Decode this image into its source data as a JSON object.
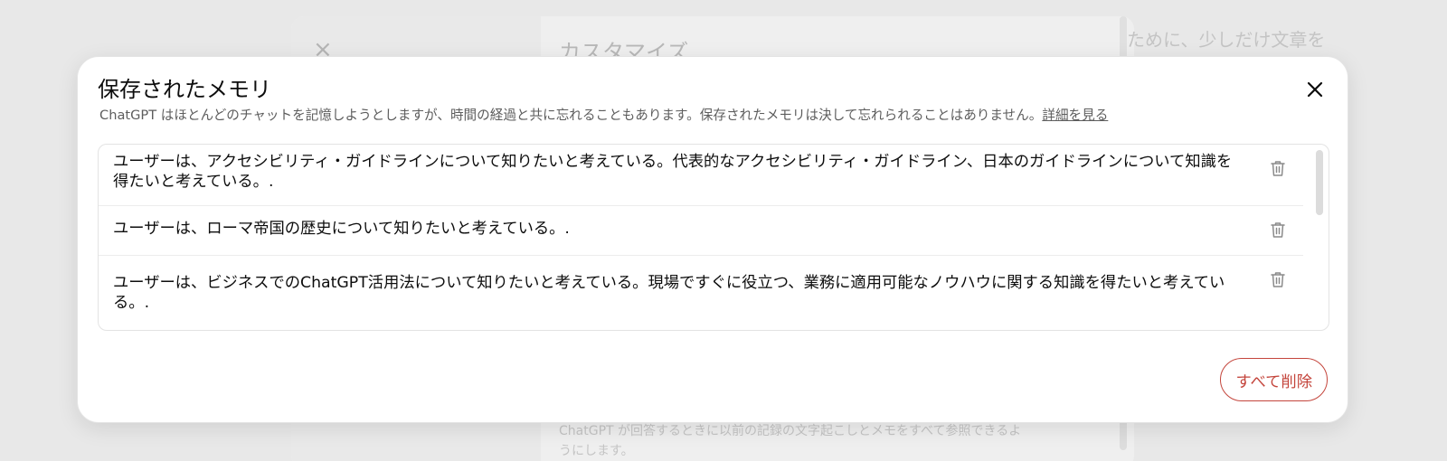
{
  "background": {
    "title": "カスタマイズ",
    "right_text": "ために、少しだけ文章を",
    "bottom_text": "ChatGPT が回答するときに以前の記録の文字起こしとメモをすべて参照できるようにします。"
  },
  "modal": {
    "title": "保存されたメモリ",
    "description": "ChatGPT はほとんどのチャットを記憶しようとしますが、時間の経過と共に忘れることもあります。保存されたメモリは決して忘れられることはありません。",
    "learn_more": "詳細を見る",
    "delete_all_label": "すべて削除"
  },
  "memories": [
    {
      "text": "ユーザーは、アクセシビリティ・ガイドラインについて知りたいと考えている。代表的なアクセシビリティ・ガイドライン、日本のガイドラインについて知識を得たいと考えている。."
    },
    {
      "text": "ユーザーは、ローマ帝国の歴史について知りたいと考えている。."
    },
    {
      "text": "ユーザーは、ビジネスでのChatGPT活用法について知りたいと考えている。現場ですぐに役立つ、業務に適用可能なノウハウに関する知識を得たいと考えている。."
    }
  ],
  "colors": {
    "danger": "#c4453c",
    "text": "#0d0d0d",
    "muted": "#5d5d5d"
  },
  "icons": {
    "close": "close-icon",
    "trash": "trash-icon"
  }
}
